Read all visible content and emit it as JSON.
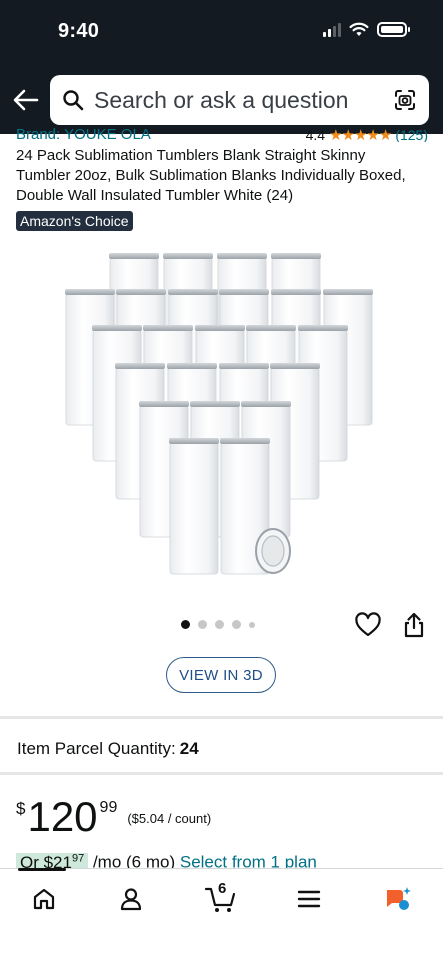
{
  "status_bar": {
    "time": "9:40"
  },
  "search": {
    "placeholder": "Search or ask a question"
  },
  "product": {
    "brand": "Brand: YOUKE OLA",
    "rating_value": "4.4",
    "rating_stars": "★★★★★",
    "review_count": "(125)",
    "title": "24 Pack Sublimation Tumblers Blank Straight Skinny Tumbler 20oz, Bulk Sublimation Blanks Individually Boxed, Double Wall Insulated Tumbler White (24)",
    "badge": "Amazon's Choice",
    "image_alt_icon": "tumbler-set-image"
  },
  "carousel": {
    "total_dots": 5,
    "active_index": 0
  },
  "actions": {
    "view_3d_label": "VIEW IN 3D"
  },
  "quantity": {
    "label": "Item Parcel Quantity:",
    "value": "24"
  },
  "price": {
    "currency": "$",
    "whole": "120",
    "fraction": "99",
    "per_unit": "($5.04 / count)"
  },
  "plan": {
    "prefix": "Or $21",
    "cents": "97",
    "term": " /mo (6 mo) ",
    "link": "Select from 1 plan"
  },
  "bottom_nav": {
    "cart_count": "6",
    "items": [
      "home-icon",
      "account-icon",
      "cart-icon",
      "menu-icon",
      "rufus-icon"
    ]
  },
  "colors": {
    "header_bg": "#131a22",
    "link": "#007185",
    "star": "#f08c19",
    "badge_bg": "#232f3e",
    "view3d_border": "#2f5a8a"
  }
}
